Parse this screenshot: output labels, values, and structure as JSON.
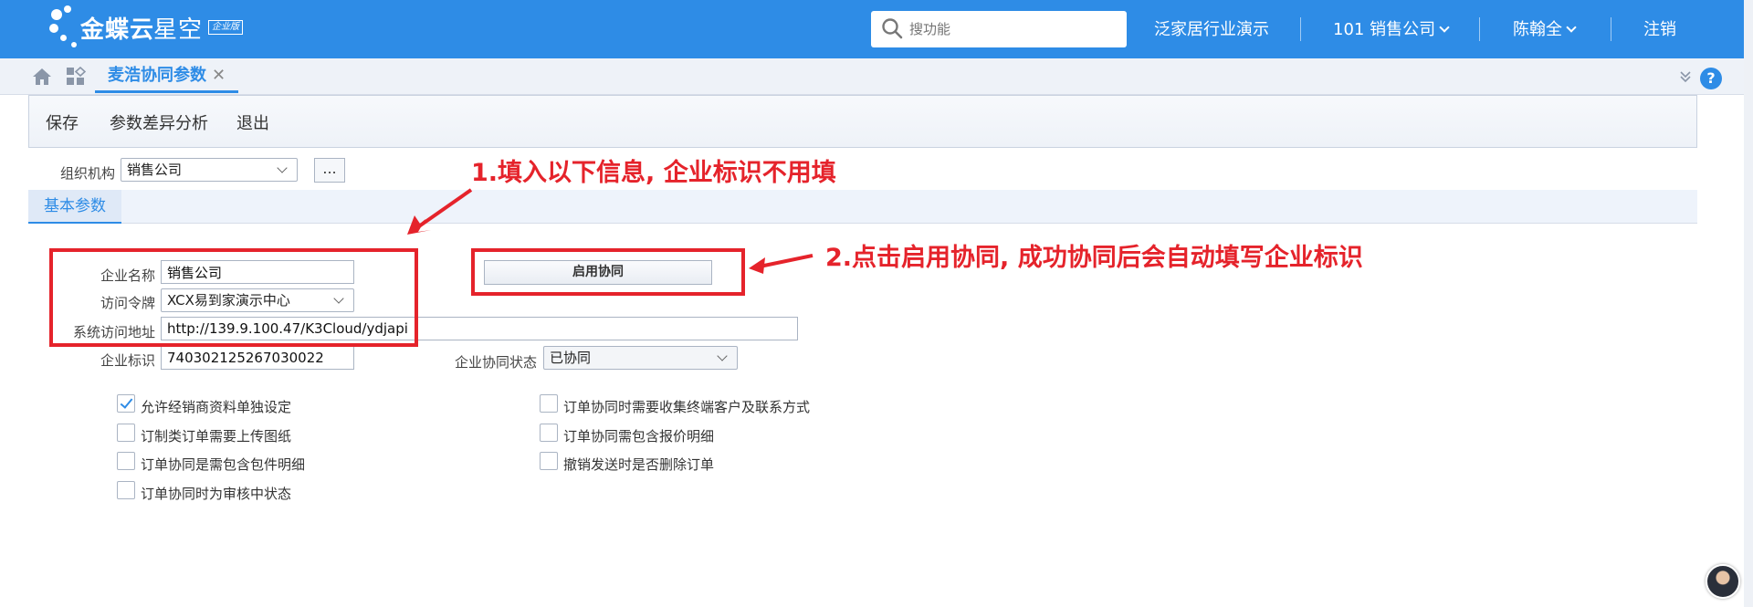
{
  "header": {
    "logo_main": "金蝶云",
    "logo_sub": "星空",
    "logo_badge": "企业版",
    "search_placeholder": "搜功能",
    "links": {
      "industry": "泛家居行业演示",
      "company": "101 销售公司",
      "user": "陈翰全",
      "logout": "注销"
    }
  },
  "tabs": {
    "active_label": "麦浩协同参数",
    "close_glyph": "✕",
    "help_glyph": "?"
  },
  "toolbar": {
    "save": "保存",
    "diff": "参数差异分析",
    "exit": "退出"
  },
  "org": {
    "label": "组织机构",
    "value": "销售公司",
    "more": "..."
  },
  "subtab": {
    "label": "基本参数"
  },
  "form": {
    "company_name_label": "企业名称",
    "company_name_value": "销售公司",
    "token_label": "访问令牌",
    "token_value": "XCX易到家演示中心",
    "url_label": "系统访问地址",
    "url_value": "http://139.9.100.47/K3Cloud/ydjapi",
    "enterprise_id_label": "企业标识",
    "enterprise_id_value": "740302125267030022",
    "status_label": "企业协同状态",
    "status_value": "已协同",
    "enable_button": "启用协同"
  },
  "annotations": {
    "step1": "1.填入以下信息, 企业标识不用填",
    "step2": "2.点击启用协同, 成功协同后会自动填写企业标识",
    "color": "#e5232b"
  },
  "options": [
    {
      "label": "允许经销商资料单独设定",
      "checked": true
    },
    {
      "label": "订制类订单需要上传图纸",
      "checked": false
    },
    {
      "label": "订单协同是需包含包件明细",
      "checked": false
    },
    {
      "label": "订单协同时为审核中状态",
      "checked": false
    },
    {
      "label": "订单协同时需要收集终端客户及联系方式",
      "checked": false
    },
    {
      "label": "订单协同需包含报价明细",
      "checked": false
    },
    {
      "label": "撤销发送时是否删除订单",
      "checked": false
    }
  ],
  "colors": {
    "brand_blue": "#2e8ce6",
    "annotation_red": "#e5232b"
  }
}
